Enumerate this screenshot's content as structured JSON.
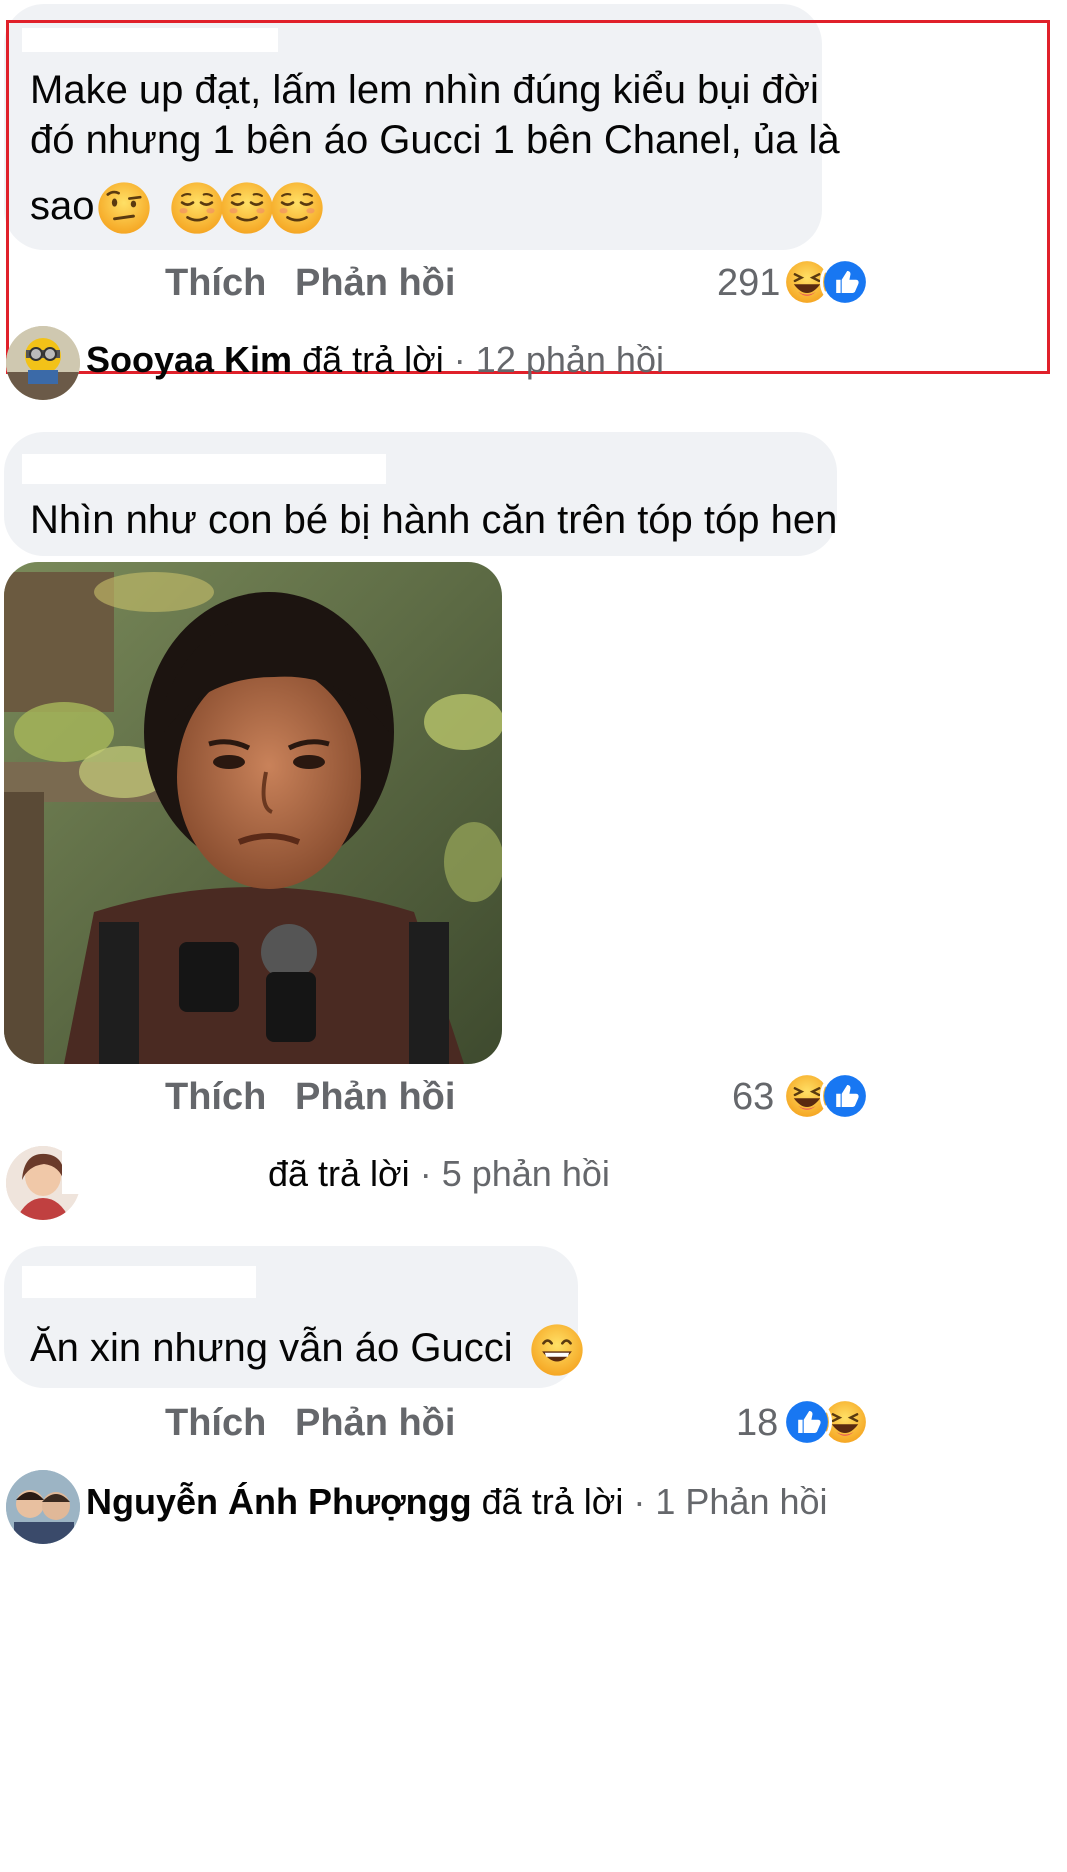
{
  "comments": [
    {
      "text_lines": [
        "Make up đạt, lấm lem nhìn đúng kiểu bụi đời",
        "đó nhưng 1 bên áo Gucci 1 bên Chanel, ủa là",
        "sao"
      ],
      "emojis": [
        "raised-eyebrow-emoji",
        "relieved-face-emoji",
        "relieved-face-emoji",
        "relieved-face-emoji"
      ],
      "like_label": "Thích",
      "reply_label": "Phản hồi",
      "reaction_count": "291",
      "reactions": [
        "haha",
        "like"
      ],
      "reply_summary": {
        "name": "Sooyaa Kim",
        "action": "đã trả lời",
        "count": "12 phản hồi"
      }
    },
    {
      "text_lines": [
        "Nhìn như con bé bị hành căn trên tóp tóp hen"
      ],
      "like_label": "Thích",
      "reply_label": "Phản hồi",
      "reaction_count": "63",
      "reactions": [
        "haha",
        "like"
      ],
      "reply_summary": {
        "name": "",
        "action": "đã trả lời",
        "count": "5 phản hồi"
      }
    },
    {
      "text_lines": [
        "Ăn xin nhưng vẫn áo Gucci"
      ],
      "emojis": [
        "grinning-face-emoji"
      ],
      "like_label": "Thích",
      "reply_label": "Phản hồi",
      "reaction_count": "18",
      "reactions": [
        "like",
        "haha"
      ],
      "reply_summary": {
        "name": "Nguyễn Ánh Phượngg",
        "action": "đã trả lời",
        "count": "1 Phản hồi"
      }
    }
  ],
  "colors": {
    "bubble": "#f0f2f5",
    "secondary_text": "#65676b",
    "highlight_border": "#e0202a",
    "like_blue": "#1877f2",
    "haha_yellow": "#f7b125"
  }
}
